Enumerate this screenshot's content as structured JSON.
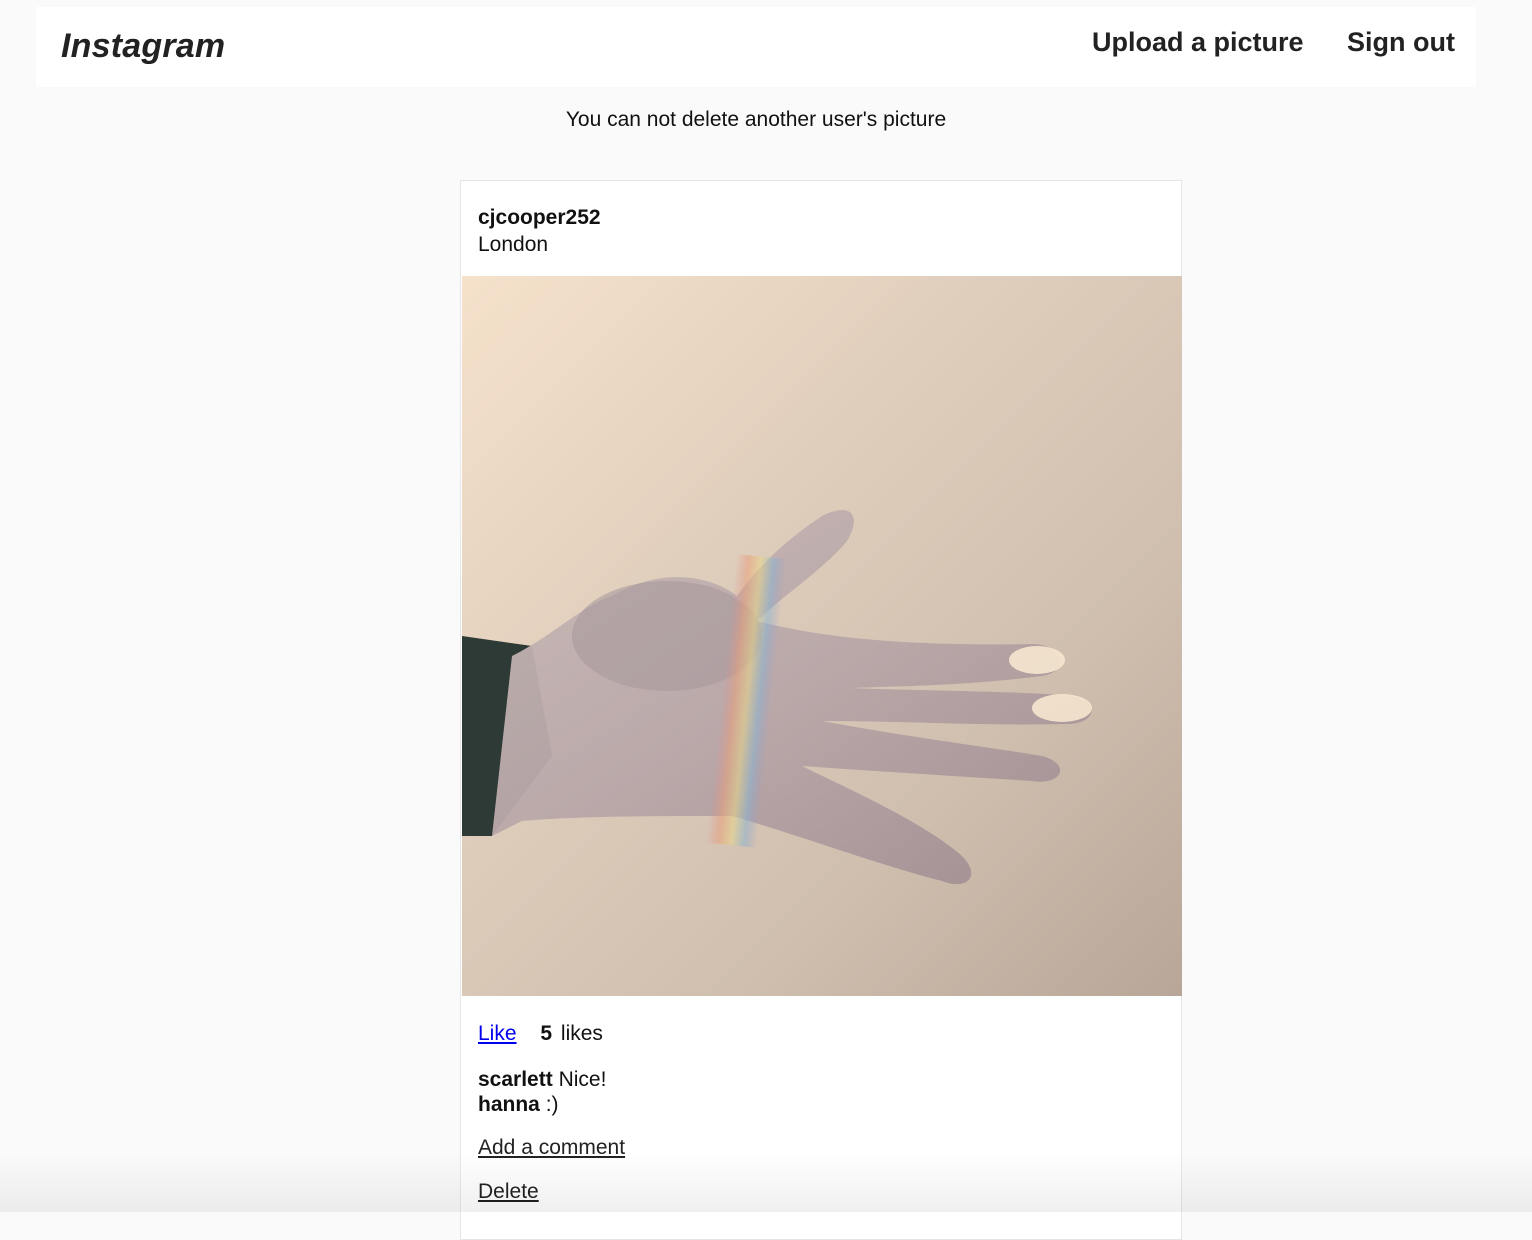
{
  "navbar": {
    "brand": "Instagram",
    "upload_label": "Upload a picture",
    "signout_label": "Sign out"
  },
  "flash": {
    "message": "You can not delete another user's picture"
  },
  "post": {
    "username": "cjcooper252",
    "location": "London",
    "image_alt": "Open hand with a rainbow light streak across the palm",
    "like_label": "Like",
    "likes_count": "5",
    "likes_word": "likes",
    "comments": [
      {
        "author": "scarlett",
        "text": "Nice!"
      },
      {
        "author": "hanna",
        "text": ":)"
      }
    ],
    "add_comment_label": "Add a comment",
    "delete_label": "Delete"
  },
  "colors": {
    "background": "#fafafa",
    "card": "#ffffff",
    "link_blue": "#0000ee",
    "text": "#111111"
  }
}
